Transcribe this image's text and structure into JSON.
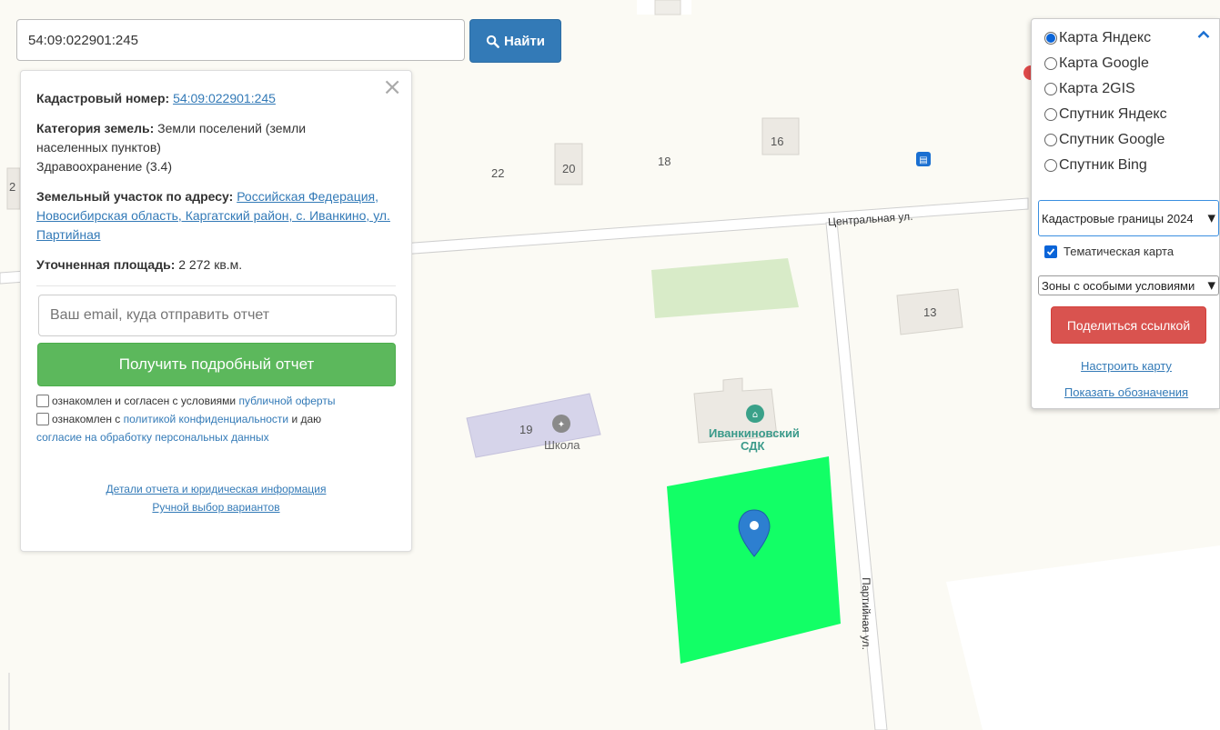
{
  "search": {
    "value": "54:09:022901:245",
    "button_label": "Найти"
  },
  "info": {
    "cadastral_label": "Кадастровый номер:",
    "cadastral_value": "54:09:022901:245",
    "category_label": "Категория земель:",
    "category_value": "Земли поселений (земли населенных пунктов)",
    "category_extra": "Здравоохранение (3.4)",
    "address_label": "Земельный участок по адресу:",
    "address_value": "Российская Федерация, Новосибирская область, Каргатский район, с. Иванкино, ул. Партийная",
    "area_label": "Уточненная площадь:",
    "area_value": "2 272",
    "area_unit": "кв.м.",
    "email_placeholder": "Ваш email, куда отправить отчет",
    "report_button": "Получить подробный отчет",
    "consent1_text": "ознакомлен и согласен с условиями",
    "consent1_link": "публичной оферты",
    "consent2_text_a": "ознакомлен с",
    "consent2_link_a": "политикой конфиденциальности",
    "consent2_text_b": "и даю",
    "consent2_link_b": "согласие на обработку персональных данных",
    "details_link": "Детали отчета и юридическая информация",
    "manual_link": "Ручной выбор вариантов"
  },
  "layers": {
    "options": [
      {
        "label": "Карта Яндекс",
        "checked": true
      },
      {
        "label": "Карта Google",
        "checked": false
      },
      {
        "label": "Карта 2GIS",
        "checked": false
      },
      {
        "label": "Спутник Яндекс",
        "checked": false
      },
      {
        "label": "Спутник Google",
        "checked": false
      },
      {
        "label": "Спутник Bing",
        "checked": false
      }
    ],
    "boundaries_select": "Кадастровые границы 2024",
    "thematic_label": "Тематическая карта",
    "zones_select": "Зоны с особыми условиями",
    "share_button": "Поделиться ссылкой",
    "configure_link": "Настроить карту",
    "legend_link": "Показать обозначения"
  },
  "map": {
    "street_central": "Центральная ул.",
    "street_party": "Партийная ул.",
    "house_numbers": [
      "22",
      "20",
      "18",
      "16",
      "13",
      "19",
      "2"
    ],
    "school_label": "Школа",
    "sdk_label_1": "Иванкиновский",
    "sdk_label_2": "СДК",
    "parcel_color": "#12ff66",
    "accent": "#337ab7"
  }
}
